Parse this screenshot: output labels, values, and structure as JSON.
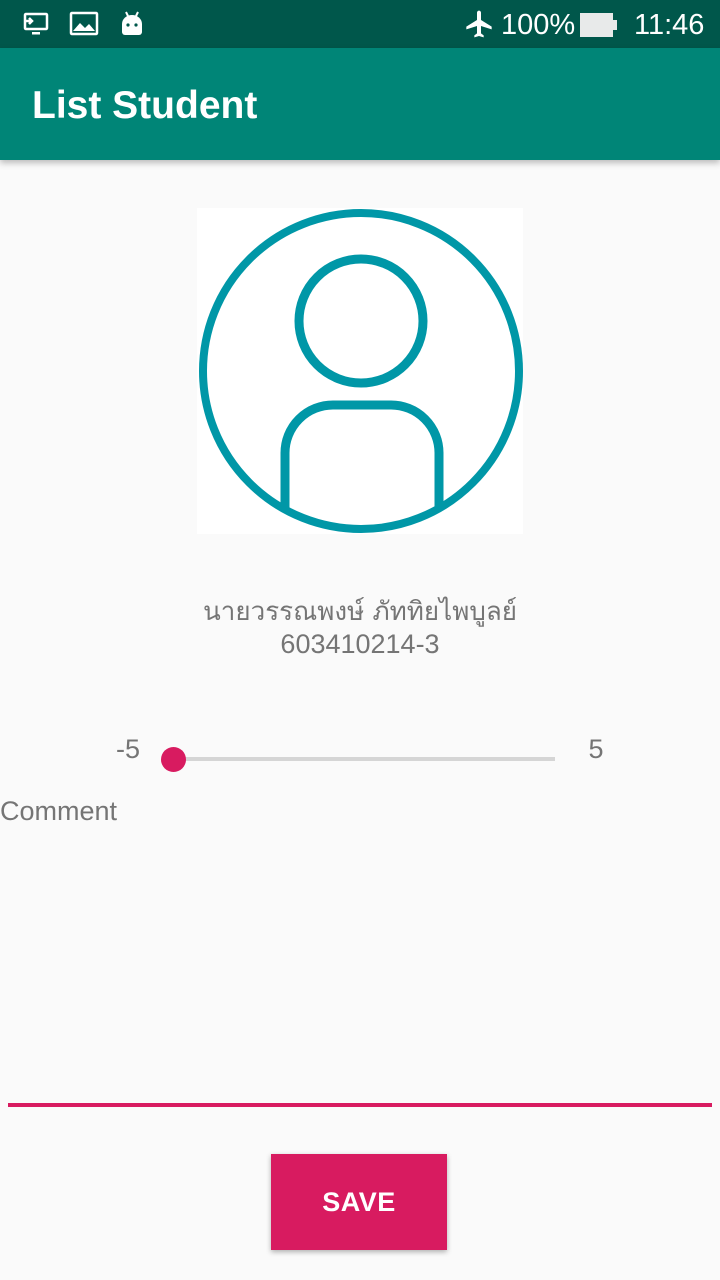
{
  "status_bar": {
    "battery": "100%",
    "time": "11:46",
    "icons": [
      "screen-cast-icon",
      "image-icon",
      "android-icon",
      "airplane-mode-icon",
      "battery-icon"
    ]
  },
  "app_bar": {
    "title": "List Student"
  },
  "student": {
    "avatar_icon": "person-avatar-icon",
    "name": "นายวรรณพงษ์ ภัททิยไพบูลย์",
    "id": "603410214-3"
  },
  "rating_slider": {
    "min_label": "-5",
    "max_label": "5",
    "min": -5,
    "max": 5,
    "value": -5
  },
  "comment": {
    "label": "Comment",
    "value": ""
  },
  "save_button": {
    "label": "SAVE"
  },
  "colors": {
    "status_bar": "#00574b",
    "app_bar": "#008577",
    "accent": "#d81b60",
    "avatar_stroke": "#0097a7",
    "background": "#fafafa",
    "secondary_text": "#757575"
  }
}
